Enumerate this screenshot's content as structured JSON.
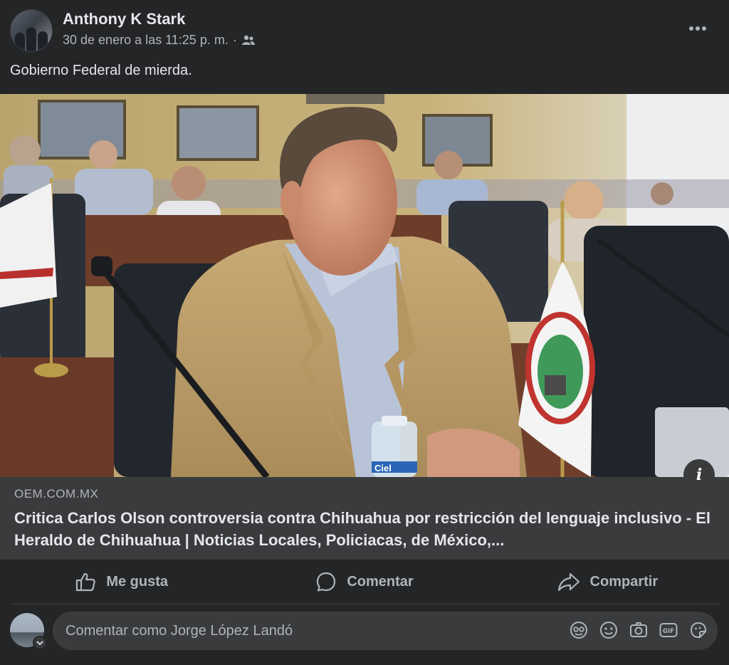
{
  "post": {
    "author": "Anthony K Stark",
    "timestamp": "30 de enero a las 11:25 p. m.",
    "separator": "·",
    "audience_icon": "friends-icon",
    "text": "Gobierno Federal de mierda."
  },
  "link": {
    "domain": "OEM.COM.MX",
    "title": "Critica Carlos Olson controversia contra Chihuahua por restricción del lenguaje inclusivo - El Heraldo de Chihuahua | Noticias Locales, Policiacas, de México,..."
  },
  "image": {
    "bottle_label": "Ciel"
  },
  "actions": {
    "like": "Me gusta",
    "comment": "Comentar",
    "share": "Compartir"
  },
  "comment_input": {
    "placeholder": "Comentar como Jorge López Landó"
  },
  "colors": {
    "background": "#242526",
    "card": "#3a3b3c",
    "text_primary": "#e4e6eb",
    "text_secondary": "#b0b3b8"
  }
}
